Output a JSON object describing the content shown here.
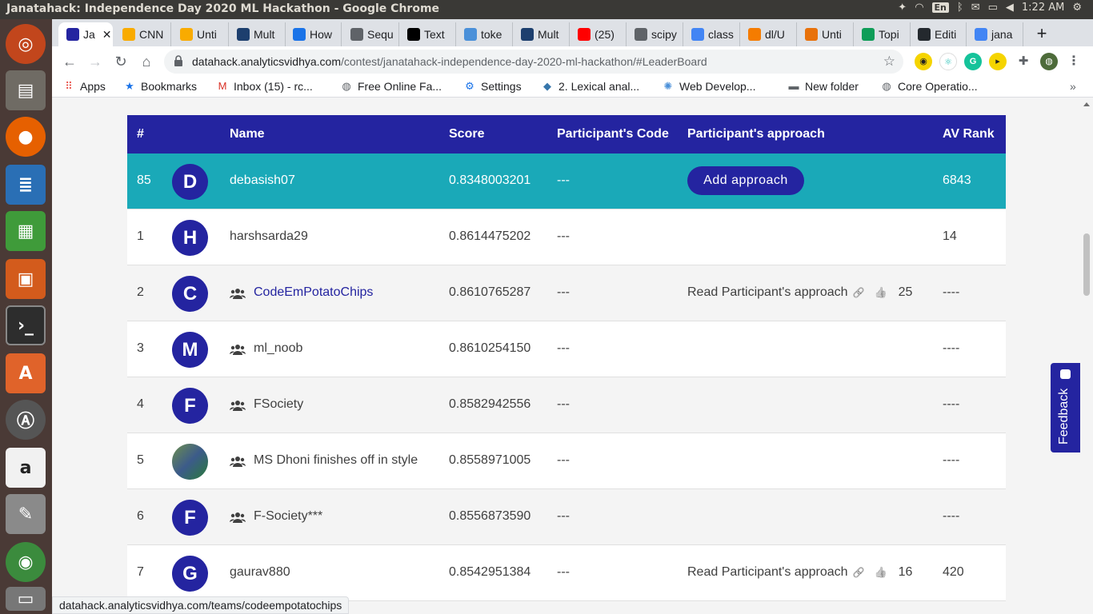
{
  "system": {
    "window_title": "Janatahack: Independence Day 2020 ML Hackathon - Google Chrome",
    "language": "En",
    "time": "1:22 AM"
  },
  "launcher": {
    "items": [
      "ubuntu-icon",
      "files-icon",
      "firefox-icon",
      "writer-icon",
      "calc-icon",
      "impress-icon",
      "terminal-icon",
      "software-center-icon",
      "updater-icon",
      "amazon-icon",
      "settings-icon",
      "chrome-icon",
      "trash-icon"
    ]
  },
  "tabs": [
    {
      "label": "Ja",
      "color": "#2424a0"
    },
    {
      "label": "CNN",
      "color": "#f9ab00"
    },
    {
      "label": "Unti",
      "color": "#f9ab00"
    },
    {
      "label": "Mult",
      "color": "#1d3f6e"
    },
    {
      "label": "How",
      "color": "#1a73e8"
    },
    {
      "label": "Sequ",
      "color": "#5f6368"
    },
    {
      "label": "Text",
      "color": "#000000"
    },
    {
      "label": "toke",
      "color": "#4a90d9"
    },
    {
      "label": "Mult",
      "color": "#1d3f6e"
    },
    {
      "label": "(25)",
      "color": "#ff0000"
    },
    {
      "label": "scipy",
      "color": "#5f6368"
    },
    {
      "label": "class",
      "color": "#4285f4"
    },
    {
      "label": "dl/U",
      "color": "#f57c00"
    },
    {
      "label": "Unti",
      "color": "#e8710a"
    },
    {
      "label": "Topi",
      "color": "#0f9d58"
    },
    {
      "label": "Editi",
      "color": "#24292e"
    },
    {
      "label": "jana",
      "color": "#4285f4"
    }
  ],
  "toolbar": {
    "url_host": "datahack.analyticsvidhya.com",
    "url_path": "/contest/janatahack-independence-day-2020-ml-hackathon/#LeaderBoard"
  },
  "bookmarks": [
    {
      "label": "Apps",
      "icon": "apps-grid-icon"
    },
    {
      "label": "Bookmarks",
      "icon": "star-icon"
    },
    {
      "label": "Inbox (15) - rc...",
      "icon": "gmail-icon"
    },
    {
      "label": "Free Online Fa...",
      "icon": "globe-icon"
    },
    {
      "label": "Settings",
      "icon": "gear-icon"
    },
    {
      "label": "2. Lexical anal...",
      "icon": "python-icon"
    },
    {
      "label": "Web Develop...",
      "icon": "web-icon"
    },
    {
      "label": "New folder",
      "icon": "folder-icon"
    },
    {
      "label": "Core Operatio...",
      "icon": "globe-icon"
    }
  ],
  "leaderboard": {
    "headers": {
      "rank": "#",
      "name": "Name",
      "score": "Score",
      "code": "Participant's Code",
      "approach": "Participant's approach",
      "av_rank": "AV Rank"
    },
    "current_user": {
      "rank": "85",
      "initial": "D",
      "name": "debasish07",
      "score": "0.8348003201",
      "code": "---",
      "add_approach": "Add approach",
      "av_rank": "6843"
    },
    "rows": [
      {
        "rank": "1",
        "initial": "H",
        "name": "harshsarda29",
        "team": false,
        "score": "0.8614475202",
        "code": "---",
        "approach": "",
        "likes": "",
        "av_rank": "14"
      },
      {
        "rank": "2",
        "initial": "C",
        "name": "CodeEmPotatoChips",
        "team": true,
        "score": "0.8610765287",
        "code": "---",
        "approach": "Read Participant's approach",
        "likes": "25",
        "av_rank": "----"
      },
      {
        "rank": "3",
        "initial": "M",
        "name": "ml_noob",
        "team": true,
        "score": "0.8610254150",
        "code": "---",
        "approach": "",
        "likes": "",
        "av_rank": "----"
      },
      {
        "rank": "4",
        "initial": "F",
        "name": "FSociety",
        "team": true,
        "score": "0.8582942556",
        "code": "---",
        "approach": "",
        "likes": "",
        "av_rank": "----"
      },
      {
        "rank": "5",
        "initial": "",
        "name": "MS Dhoni finishes off in style",
        "team": true,
        "score": "0.8558971005",
        "code": "---",
        "approach": "",
        "likes": "",
        "av_rank": "----"
      },
      {
        "rank": "6",
        "initial": "F",
        "name": "F-Society***",
        "team": true,
        "score": "0.8556873590",
        "code": "---",
        "approach": "",
        "likes": "",
        "av_rank": "----"
      },
      {
        "rank": "7",
        "initial": "G",
        "name": "gaurav880",
        "team": false,
        "score": "0.8542951384",
        "code": "---",
        "approach": "Read Participant's approach",
        "likes": "16",
        "av_rank": "420"
      }
    ]
  },
  "feedback_label": "Feedback",
  "status_url": "datahack.analyticsvidhya.com/teams/codeempotatochips",
  "colors": {
    "primary": "#2424a0",
    "highlight": "#1aa9b8"
  }
}
